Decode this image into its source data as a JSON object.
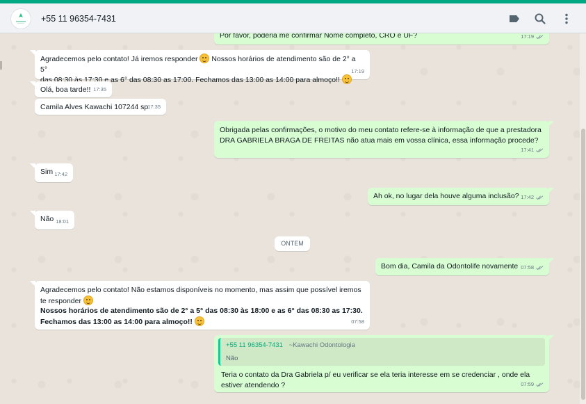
{
  "header": {
    "contact_name": "+55 11 96354-7431",
    "icons": [
      "label-icon",
      "search-icon",
      "menu-icon"
    ]
  },
  "colors": {
    "accent": "#00a884",
    "incoming_bubble": "#ffffff",
    "outgoing_bubble": "#d9fdd3",
    "chat_background": "#e9e3dc"
  },
  "messages": [
    {
      "dir": "out",
      "text": "Por favor, poderia me confirmar Nome completo, CRO e UF?",
      "time": "17:19"
    },
    {
      "dir": "in",
      "text": "Agradecemos pelo contato! Já iremos responder 😀 Nossos horários de atendimento são de 2° a 5° das 08:30 às 17:30 e as 6° das 08:30 as 17:00. Fechamos das 13:00 as 14:00 para almoço!! 😌",
      "time": "17:19"
    },
    {
      "dir": "in",
      "text": "Olá, boa tarde!!",
      "time": "17:35"
    },
    {
      "dir": "in",
      "text": "Camila Alves Kawachi 107244 sp",
      "time": "17:35"
    },
    {
      "dir": "out",
      "text": "Obrigada pelas confirmações, o motivo do meu contato refere-se à informação de que a prestadora DRA GABRIELA BRAGA DE FREITAS não atua mais em vossa clínica, essa informação procede?",
      "time": "17:41"
    },
    {
      "dir": "in",
      "text": "Sim",
      "time": "17:42"
    },
    {
      "dir": "out",
      "text": "Ah ok, no lugar dela houve alguma inclusão?",
      "time": "17:42"
    },
    {
      "dir": "in",
      "text": "Não",
      "time": "18:01"
    },
    {
      "dir": "date",
      "text": "ONTEM"
    },
    {
      "dir": "out",
      "text": "Bom dia, Camila da Odontolife novamente",
      "time": "07:58"
    },
    {
      "dir": "in",
      "text": "Agradecemos pelo contato! Não estamos disponíveis no momento, mas assim que possível iremos te responder 😀",
      "bold_text": "Nossos horários de atendimento são de 2° a 5° das 08:30 às 18:00 e as 6° das 08:30 as 17:30. Fechamos das 13:00 as 14:00 para almoço!! 😌",
      "time": "07:58"
    },
    {
      "dir": "out",
      "quote": {
        "phone": "+55 11 96354-7431",
        "alias": "~Kawachi Odontologia",
        "text": "Não"
      },
      "text": "Teria o contato da Dra Gabriela p/ eu verificar se ela teria interesse em se credenciar , onde ela estiver atendendo ?",
      "time": "07:59"
    }
  ],
  "ui": {
    "m1_text": "Por favor, poderia me confirmar Nome completo, CRO e UF?",
    "m1_time": "17:19",
    "m2_a": "Agradecemos pelo contato! Já iremos responder",
    "m2_b": "Nossos horários de atendimento são de 2° a 5°",
    "m2_c": "das 08:30 às 17:30 e as 6° das 08:30 as 17:00. Fechamos das 13:00 as 14:00 para almoço!!",
    "m2_time": "17:19",
    "m3_text": "Olá, boa tarde!!",
    "m3_time": "17:35",
    "m4_text": "Camila Alves Kawachi 107244 sp",
    "m4_time": "17:35",
    "m5_text": "Obrigada pelas confirmações, o motivo do meu contato refere-se à informação de que a prestadora DRA GABRIELA BRAGA DE FREITAS não atua mais em vossa clínica, essa informação procede?",
    "m5_time": "17:41",
    "m6_text": "Sim",
    "m6_time": "17:42",
    "m7_text": "Ah ok, no lugar dela houve alguma inclusão?",
    "m7_time": "17:42",
    "m8_text": "Não",
    "m8_time": "18:01",
    "date_chip": "ONTEM",
    "m9_text": "Bom dia, Camila da Odontolife novamente",
    "m9_time": "07:58",
    "m10_a": "Agradecemos pelo contato! Não estamos disponíveis no momento, mas assim que possível iremos te responder",
    "m10_bold": "Nossos horários de atendimento são de 2° a 5° das 08:30 às 18:00 e as 6° das 08:30 as 17:30. Fechamos das 13:00 as 14:00 para almoço!!",
    "m10_time": "07:58",
    "m11_quote_phone": "+55 11 96354-7431",
    "m11_quote_alias": "~Kawachi Odontologia",
    "m11_quote_text": "Não",
    "m11_text": "Teria o contato da Dra Gabriela p/ eu verificar se ela teria interesse em se credenciar , onde ela estiver atendendo ?",
    "m11_time": "07:59"
  }
}
